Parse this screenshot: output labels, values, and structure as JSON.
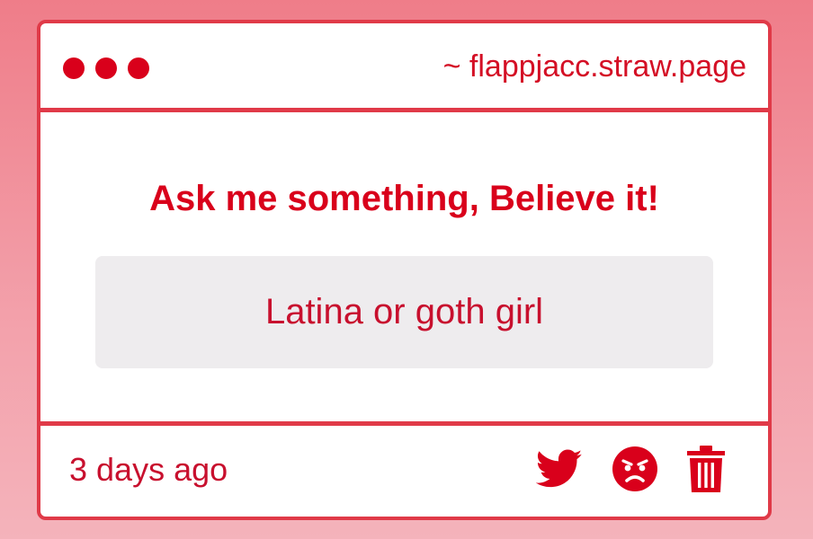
{
  "window": {
    "url": "~ flappjacc.straw.page",
    "controls": [
      "close",
      "minimize",
      "maximize"
    ]
  },
  "content": {
    "heading": "Ask me something, Believe it!",
    "question": "Latina or goth girl"
  },
  "footer": {
    "timestamp": "3 days ago",
    "actions": [
      {
        "icon": "twitter-icon"
      },
      {
        "icon": "angry-face-icon"
      },
      {
        "icon": "trash-icon"
      }
    ]
  },
  "colors": {
    "accent": "#d9001b",
    "border": "#e03a48",
    "box_bg": "#eeecee",
    "bg_top": "#ef7d89",
    "bg_bottom": "#f4b3bb"
  }
}
